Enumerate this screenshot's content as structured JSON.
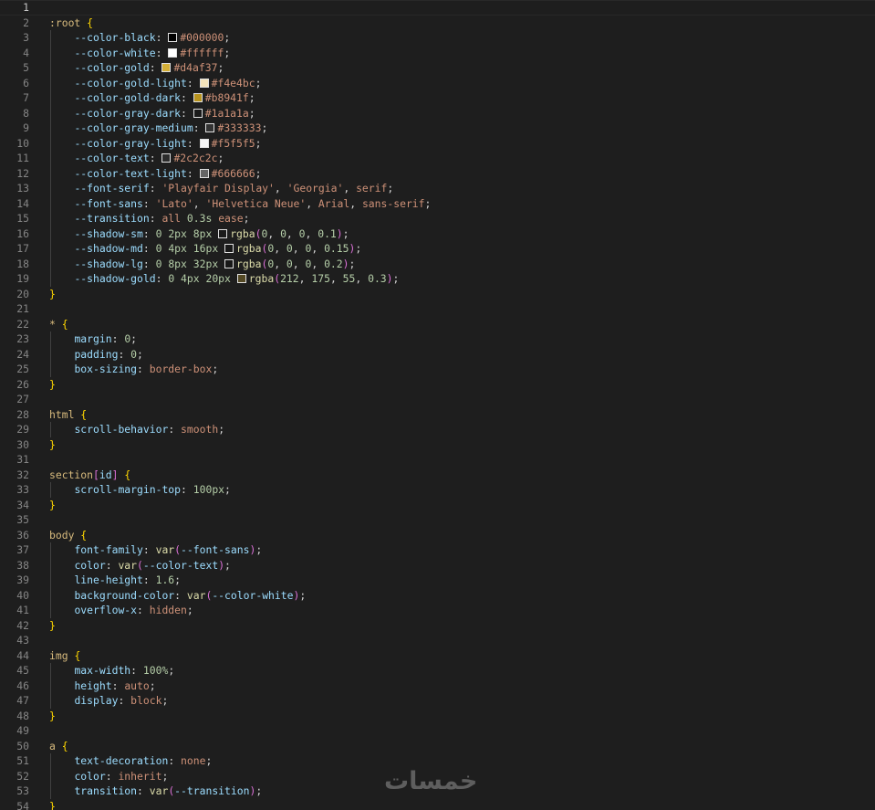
{
  "editor": {
    "lines": [
      [],
      [
        [
          "sel",
          ":root"
        ],
        [
          "punc",
          " "
        ],
        [
          "brace",
          "{"
        ]
      ],
      [
        [
          "ws",
          "    "
        ],
        [
          "prop",
          "--color-black"
        ],
        [
          "punc",
          ": "
        ],
        [
          "sw",
          "#000000"
        ],
        [
          "str",
          "#000000"
        ],
        [
          "punc",
          ";"
        ]
      ],
      [
        [
          "ws",
          "    "
        ],
        [
          "prop",
          "--color-white"
        ],
        [
          "punc",
          ": "
        ],
        [
          "sw",
          "#ffffff"
        ],
        [
          "str",
          "#ffffff"
        ],
        [
          "punc",
          ";"
        ]
      ],
      [
        [
          "ws",
          "    "
        ],
        [
          "prop",
          "--color-gold"
        ],
        [
          "punc",
          ": "
        ],
        [
          "sw",
          "#d4af37"
        ],
        [
          "str",
          "#d4af37"
        ],
        [
          "punc",
          ";"
        ]
      ],
      [
        [
          "ws",
          "    "
        ],
        [
          "prop",
          "--color-gold-light"
        ],
        [
          "punc",
          ": "
        ],
        [
          "sw",
          "#f4e4bc"
        ],
        [
          "str",
          "#f4e4bc"
        ],
        [
          "punc",
          ";"
        ]
      ],
      [
        [
          "ws",
          "    "
        ],
        [
          "prop",
          "--color-gold-dark"
        ],
        [
          "punc",
          ": "
        ],
        [
          "sw",
          "#b8941f"
        ],
        [
          "str",
          "#b8941f"
        ],
        [
          "punc",
          ";"
        ]
      ],
      [
        [
          "ws",
          "    "
        ],
        [
          "prop",
          "--color-gray-dark"
        ],
        [
          "punc",
          ": "
        ],
        [
          "sw",
          "#1a1a1a"
        ],
        [
          "str",
          "#1a1a1a"
        ],
        [
          "punc",
          ";"
        ]
      ],
      [
        [
          "ws",
          "    "
        ],
        [
          "prop",
          "--color-gray-medium"
        ],
        [
          "punc",
          ": "
        ],
        [
          "sw",
          "#333333"
        ],
        [
          "str",
          "#333333"
        ],
        [
          "punc",
          ";"
        ]
      ],
      [
        [
          "ws",
          "    "
        ],
        [
          "prop",
          "--color-gray-light"
        ],
        [
          "punc",
          ": "
        ],
        [
          "sw",
          "#f5f5f5"
        ],
        [
          "str",
          "#f5f5f5"
        ],
        [
          "punc",
          ";"
        ]
      ],
      [
        [
          "ws",
          "    "
        ],
        [
          "prop",
          "--color-text"
        ],
        [
          "punc",
          ": "
        ],
        [
          "sw",
          "#2c2c2c"
        ],
        [
          "str",
          "#2c2c2c"
        ],
        [
          "punc",
          ";"
        ]
      ],
      [
        [
          "ws",
          "    "
        ],
        [
          "prop",
          "--color-text-light"
        ],
        [
          "punc",
          ": "
        ],
        [
          "sw",
          "#666666"
        ],
        [
          "str",
          "#666666"
        ],
        [
          "punc",
          ";"
        ]
      ],
      [
        [
          "ws",
          "    "
        ],
        [
          "prop",
          "--font-serif"
        ],
        [
          "punc",
          ": "
        ],
        [
          "str",
          "'Playfair Display'"
        ],
        [
          "punc",
          ", "
        ],
        [
          "str",
          "'Georgia'"
        ],
        [
          "punc",
          ", "
        ],
        [
          "kw",
          "serif"
        ],
        [
          "punc",
          ";"
        ]
      ],
      [
        [
          "ws",
          "    "
        ],
        [
          "prop",
          "--font-sans"
        ],
        [
          "punc",
          ": "
        ],
        [
          "str",
          "'Lato'"
        ],
        [
          "punc",
          ", "
        ],
        [
          "str",
          "'Helvetica Neue'"
        ],
        [
          "punc",
          ", "
        ],
        [
          "kw",
          "Arial"
        ],
        [
          "punc",
          ", "
        ],
        [
          "kw",
          "sans-serif"
        ],
        [
          "punc",
          ";"
        ]
      ],
      [
        [
          "ws",
          "    "
        ],
        [
          "prop",
          "--transition"
        ],
        [
          "punc",
          ": "
        ],
        [
          "kw",
          "all"
        ],
        [
          "punc",
          " "
        ],
        [
          "num",
          "0.3s"
        ],
        [
          "punc",
          " "
        ],
        [
          "kw",
          "ease"
        ],
        [
          "punc",
          ";"
        ]
      ],
      [
        [
          "ws",
          "    "
        ],
        [
          "prop",
          "--shadow-sm"
        ],
        [
          "punc",
          ": "
        ],
        [
          "num",
          "0"
        ],
        [
          "punc",
          " "
        ],
        [
          "num",
          "2px"
        ],
        [
          "punc",
          " "
        ],
        [
          "num",
          "8px"
        ],
        [
          "punc",
          " "
        ],
        [
          "sw",
          "rgba(0, 0, 0, 0.1)"
        ],
        [
          "fn",
          "rgba"
        ],
        [
          "paren",
          "("
        ],
        [
          "num",
          "0"
        ],
        [
          "punc",
          ", "
        ],
        [
          "num",
          "0"
        ],
        [
          "punc",
          ", "
        ],
        [
          "num",
          "0"
        ],
        [
          "punc",
          ", "
        ],
        [
          "num",
          "0.1"
        ],
        [
          "paren",
          ")"
        ],
        [
          "punc",
          ";"
        ]
      ],
      [
        [
          "ws",
          "    "
        ],
        [
          "prop",
          "--shadow-md"
        ],
        [
          "punc",
          ": "
        ],
        [
          "num",
          "0"
        ],
        [
          "punc",
          " "
        ],
        [
          "num",
          "4px"
        ],
        [
          "punc",
          " "
        ],
        [
          "num",
          "16px"
        ],
        [
          "punc",
          " "
        ],
        [
          "sw",
          "rgba(0, 0, 0, 0.15)"
        ],
        [
          "fn",
          "rgba"
        ],
        [
          "paren",
          "("
        ],
        [
          "num",
          "0"
        ],
        [
          "punc",
          ", "
        ],
        [
          "num",
          "0"
        ],
        [
          "punc",
          ", "
        ],
        [
          "num",
          "0"
        ],
        [
          "punc",
          ", "
        ],
        [
          "num",
          "0.15"
        ],
        [
          "paren",
          ")"
        ],
        [
          "punc",
          ";"
        ]
      ],
      [
        [
          "ws",
          "    "
        ],
        [
          "prop",
          "--shadow-lg"
        ],
        [
          "punc",
          ": "
        ],
        [
          "num",
          "0"
        ],
        [
          "punc",
          " "
        ],
        [
          "num",
          "8px"
        ],
        [
          "punc",
          " "
        ],
        [
          "num",
          "32px"
        ],
        [
          "punc",
          " "
        ],
        [
          "sw",
          "rgba(0, 0, 0, 0.2)"
        ],
        [
          "fn",
          "rgba"
        ],
        [
          "paren",
          "("
        ],
        [
          "num",
          "0"
        ],
        [
          "punc",
          ", "
        ],
        [
          "num",
          "0"
        ],
        [
          "punc",
          ", "
        ],
        [
          "num",
          "0"
        ],
        [
          "punc",
          ", "
        ],
        [
          "num",
          "0.2"
        ],
        [
          "paren",
          ")"
        ],
        [
          "punc",
          ";"
        ]
      ],
      [
        [
          "ws",
          "    "
        ],
        [
          "prop",
          "--shadow-gold"
        ],
        [
          "punc",
          ": "
        ],
        [
          "num",
          "0"
        ],
        [
          "punc",
          " "
        ],
        [
          "num",
          "4px"
        ],
        [
          "punc",
          " "
        ],
        [
          "num",
          "20px"
        ],
        [
          "punc",
          " "
        ],
        [
          "sw",
          "rgba(212, 175, 55, 0.3)"
        ],
        [
          "fn",
          "rgba"
        ],
        [
          "paren",
          "("
        ],
        [
          "num",
          "212"
        ],
        [
          "punc",
          ", "
        ],
        [
          "num",
          "175"
        ],
        [
          "punc",
          ", "
        ],
        [
          "num",
          "55"
        ],
        [
          "punc",
          ", "
        ],
        [
          "num",
          "0.3"
        ],
        [
          "paren",
          ")"
        ],
        [
          "punc",
          ";"
        ]
      ],
      [
        [
          "brace",
          "}"
        ]
      ],
      [],
      [
        [
          "sel",
          "*"
        ],
        [
          "punc",
          " "
        ],
        [
          "brace",
          "{"
        ]
      ],
      [
        [
          "ws",
          "    "
        ],
        [
          "prop",
          "margin"
        ],
        [
          "punc",
          ": "
        ],
        [
          "num",
          "0"
        ],
        [
          "punc",
          ";"
        ]
      ],
      [
        [
          "ws",
          "    "
        ],
        [
          "prop",
          "padding"
        ],
        [
          "punc",
          ": "
        ],
        [
          "num",
          "0"
        ],
        [
          "punc",
          ";"
        ]
      ],
      [
        [
          "ws",
          "    "
        ],
        [
          "prop",
          "box-sizing"
        ],
        [
          "punc",
          ": "
        ],
        [
          "kw",
          "border-box"
        ],
        [
          "punc",
          ";"
        ]
      ],
      [
        [
          "brace",
          "}"
        ]
      ],
      [],
      [
        [
          "sel",
          "html"
        ],
        [
          "punc",
          " "
        ],
        [
          "brace",
          "{"
        ]
      ],
      [
        [
          "ws",
          "    "
        ],
        [
          "prop",
          "scroll-behavior"
        ],
        [
          "punc",
          ": "
        ],
        [
          "kw",
          "smooth"
        ],
        [
          "punc",
          ";"
        ]
      ],
      [
        [
          "brace",
          "}"
        ]
      ],
      [],
      [
        [
          "sel",
          "section"
        ],
        [
          "paren",
          "["
        ],
        [
          "prop",
          "id"
        ],
        [
          "paren",
          "]"
        ],
        [
          "punc",
          " "
        ],
        [
          "brace",
          "{"
        ]
      ],
      [
        [
          "ws",
          "    "
        ],
        [
          "prop",
          "scroll-margin-top"
        ],
        [
          "punc",
          ": "
        ],
        [
          "num",
          "100px"
        ],
        [
          "punc",
          ";"
        ]
      ],
      [
        [
          "brace",
          "}"
        ]
      ],
      [],
      [
        [
          "sel",
          "body"
        ],
        [
          "punc",
          " "
        ],
        [
          "brace",
          "{"
        ]
      ],
      [
        [
          "ws",
          "    "
        ],
        [
          "prop",
          "font-family"
        ],
        [
          "punc",
          ": "
        ],
        [
          "fn",
          "var"
        ],
        [
          "paren",
          "("
        ],
        [
          "prop",
          "--font-sans"
        ],
        [
          "paren",
          ")"
        ],
        [
          "punc",
          ";"
        ]
      ],
      [
        [
          "ws",
          "    "
        ],
        [
          "prop",
          "color"
        ],
        [
          "punc",
          ": "
        ],
        [
          "fn",
          "var"
        ],
        [
          "paren",
          "("
        ],
        [
          "prop",
          "--color-text"
        ],
        [
          "paren",
          ")"
        ],
        [
          "punc",
          ";"
        ]
      ],
      [
        [
          "ws",
          "    "
        ],
        [
          "prop",
          "line-height"
        ],
        [
          "punc",
          ": "
        ],
        [
          "num",
          "1.6"
        ],
        [
          "punc",
          ";"
        ]
      ],
      [
        [
          "ws",
          "    "
        ],
        [
          "prop",
          "background-color"
        ],
        [
          "punc",
          ": "
        ],
        [
          "fn",
          "var"
        ],
        [
          "paren",
          "("
        ],
        [
          "prop",
          "--color-white"
        ],
        [
          "paren",
          ")"
        ],
        [
          "punc",
          ";"
        ]
      ],
      [
        [
          "ws",
          "    "
        ],
        [
          "prop",
          "overflow-x"
        ],
        [
          "punc",
          ": "
        ],
        [
          "kw",
          "hidden"
        ],
        [
          "punc",
          ";"
        ]
      ],
      [
        [
          "brace",
          "}"
        ]
      ],
      [],
      [
        [
          "sel",
          "img"
        ],
        [
          "punc",
          " "
        ],
        [
          "brace",
          "{"
        ]
      ],
      [
        [
          "ws",
          "    "
        ],
        [
          "prop",
          "max-width"
        ],
        [
          "punc",
          ": "
        ],
        [
          "num",
          "100%"
        ],
        [
          "punc",
          ";"
        ]
      ],
      [
        [
          "ws",
          "    "
        ],
        [
          "prop",
          "height"
        ],
        [
          "punc",
          ": "
        ],
        [
          "kw",
          "auto"
        ],
        [
          "punc",
          ";"
        ]
      ],
      [
        [
          "ws",
          "    "
        ],
        [
          "prop",
          "display"
        ],
        [
          "punc",
          ": "
        ],
        [
          "kw",
          "block"
        ],
        [
          "punc",
          ";"
        ]
      ],
      [
        [
          "brace",
          "}"
        ]
      ],
      [],
      [
        [
          "sel",
          "a"
        ],
        [
          "punc",
          " "
        ],
        [
          "brace",
          "{"
        ]
      ],
      [
        [
          "ws",
          "    "
        ],
        [
          "prop",
          "text-decoration"
        ],
        [
          "punc",
          ": "
        ],
        [
          "kw",
          "none"
        ],
        [
          "punc",
          ";"
        ]
      ],
      [
        [
          "ws",
          "    "
        ],
        [
          "prop",
          "color"
        ],
        [
          "punc",
          ": "
        ],
        [
          "kw",
          "inherit"
        ],
        [
          "punc",
          ";"
        ]
      ],
      [
        [
          "ws",
          "    "
        ],
        [
          "prop",
          "transition"
        ],
        [
          "punc",
          ": "
        ],
        [
          "fn",
          "var"
        ],
        [
          "paren",
          "("
        ],
        [
          "prop",
          "--transition"
        ],
        [
          "paren",
          ")"
        ],
        [
          "punc",
          ";"
        ]
      ],
      [
        [
          "brace",
          "}"
        ]
      ]
    ],
    "active_line": 1
  },
  "watermark": {
    "text": "خمسات"
  }
}
